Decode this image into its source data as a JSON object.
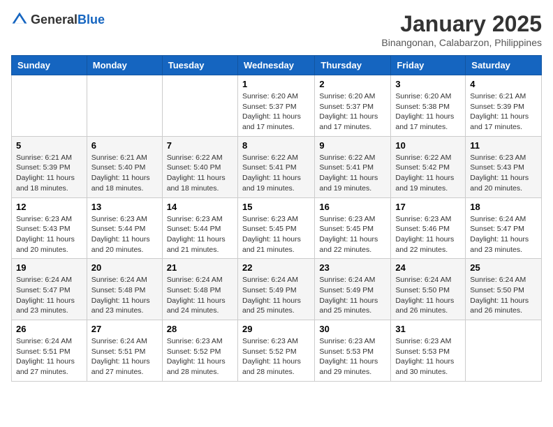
{
  "header": {
    "logo_general": "General",
    "logo_blue": "Blue",
    "month_title": "January 2025",
    "subtitle": "Binangonan, Calabarzon, Philippines"
  },
  "days_of_week": [
    "Sunday",
    "Monday",
    "Tuesday",
    "Wednesday",
    "Thursday",
    "Friday",
    "Saturday"
  ],
  "weeks": [
    [
      {
        "day": "",
        "info": ""
      },
      {
        "day": "",
        "info": ""
      },
      {
        "day": "",
        "info": ""
      },
      {
        "day": "1",
        "info": "Sunrise: 6:20 AM\nSunset: 5:37 PM\nDaylight: 11 hours\nand 17 minutes."
      },
      {
        "day": "2",
        "info": "Sunrise: 6:20 AM\nSunset: 5:37 PM\nDaylight: 11 hours\nand 17 minutes."
      },
      {
        "day": "3",
        "info": "Sunrise: 6:20 AM\nSunset: 5:38 PM\nDaylight: 11 hours\nand 17 minutes."
      },
      {
        "day": "4",
        "info": "Sunrise: 6:21 AM\nSunset: 5:39 PM\nDaylight: 11 hours\nand 17 minutes."
      }
    ],
    [
      {
        "day": "5",
        "info": "Sunrise: 6:21 AM\nSunset: 5:39 PM\nDaylight: 11 hours\nand 18 minutes."
      },
      {
        "day": "6",
        "info": "Sunrise: 6:21 AM\nSunset: 5:40 PM\nDaylight: 11 hours\nand 18 minutes."
      },
      {
        "day": "7",
        "info": "Sunrise: 6:22 AM\nSunset: 5:40 PM\nDaylight: 11 hours\nand 18 minutes."
      },
      {
        "day": "8",
        "info": "Sunrise: 6:22 AM\nSunset: 5:41 PM\nDaylight: 11 hours\nand 19 minutes."
      },
      {
        "day": "9",
        "info": "Sunrise: 6:22 AM\nSunset: 5:41 PM\nDaylight: 11 hours\nand 19 minutes."
      },
      {
        "day": "10",
        "info": "Sunrise: 6:22 AM\nSunset: 5:42 PM\nDaylight: 11 hours\nand 19 minutes."
      },
      {
        "day": "11",
        "info": "Sunrise: 6:23 AM\nSunset: 5:43 PM\nDaylight: 11 hours\nand 20 minutes."
      }
    ],
    [
      {
        "day": "12",
        "info": "Sunrise: 6:23 AM\nSunset: 5:43 PM\nDaylight: 11 hours\nand 20 minutes."
      },
      {
        "day": "13",
        "info": "Sunrise: 6:23 AM\nSunset: 5:44 PM\nDaylight: 11 hours\nand 20 minutes."
      },
      {
        "day": "14",
        "info": "Sunrise: 6:23 AM\nSunset: 5:44 PM\nDaylight: 11 hours\nand 21 minutes."
      },
      {
        "day": "15",
        "info": "Sunrise: 6:23 AM\nSunset: 5:45 PM\nDaylight: 11 hours\nand 21 minutes."
      },
      {
        "day": "16",
        "info": "Sunrise: 6:23 AM\nSunset: 5:45 PM\nDaylight: 11 hours\nand 22 minutes."
      },
      {
        "day": "17",
        "info": "Sunrise: 6:23 AM\nSunset: 5:46 PM\nDaylight: 11 hours\nand 22 minutes."
      },
      {
        "day": "18",
        "info": "Sunrise: 6:24 AM\nSunset: 5:47 PM\nDaylight: 11 hours\nand 23 minutes."
      }
    ],
    [
      {
        "day": "19",
        "info": "Sunrise: 6:24 AM\nSunset: 5:47 PM\nDaylight: 11 hours\nand 23 minutes."
      },
      {
        "day": "20",
        "info": "Sunrise: 6:24 AM\nSunset: 5:48 PM\nDaylight: 11 hours\nand 23 minutes."
      },
      {
        "day": "21",
        "info": "Sunrise: 6:24 AM\nSunset: 5:48 PM\nDaylight: 11 hours\nand 24 minutes."
      },
      {
        "day": "22",
        "info": "Sunrise: 6:24 AM\nSunset: 5:49 PM\nDaylight: 11 hours\nand 25 minutes."
      },
      {
        "day": "23",
        "info": "Sunrise: 6:24 AM\nSunset: 5:49 PM\nDaylight: 11 hours\nand 25 minutes."
      },
      {
        "day": "24",
        "info": "Sunrise: 6:24 AM\nSunset: 5:50 PM\nDaylight: 11 hours\nand 26 minutes."
      },
      {
        "day": "25",
        "info": "Sunrise: 6:24 AM\nSunset: 5:50 PM\nDaylight: 11 hours\nand 26 minutes."
      }
    ],
    [
      {
        "day": "26",
        "info": "Sunrise: 6:24 AM\nSunset: 5:51 PM\nDaylight: 11 hours\nand 27 minutes."
      },
      {
        "day": "27",
        "info": "Sunrise: 6:24 AM\nSunset: 5:51 PM\nDaylight: 11 hours\nand 27 minutes."
      },
      {
        "day": "28",
        "info": "Sunrise: 6:23 AM\nSunset: 5:52 PM\nDaylight: 11 hours\nand 28 minutes."
      },
      {
        "day": "29",
        "info": "Sunrise: 6:23 AM\nSunset: 5:52 PM\nDaylight: 11 hours\nand 28 minutes."
      },
      {
        "day": "30",
        "info": "Sunrise: 6:23 AM\nSunset: 5:53 PM\nDaylight: 11 hours\nand 29 minutes."
      },
      {
        "day": "31",
        "info": "Sunrise: 6:23 AM\nSunset: 5:53 PM\nDaylight: 11 hours\nand 30 minutes."
      },
      {
        "day": "",
        "info": ""
      }
    ]
  ]
}
